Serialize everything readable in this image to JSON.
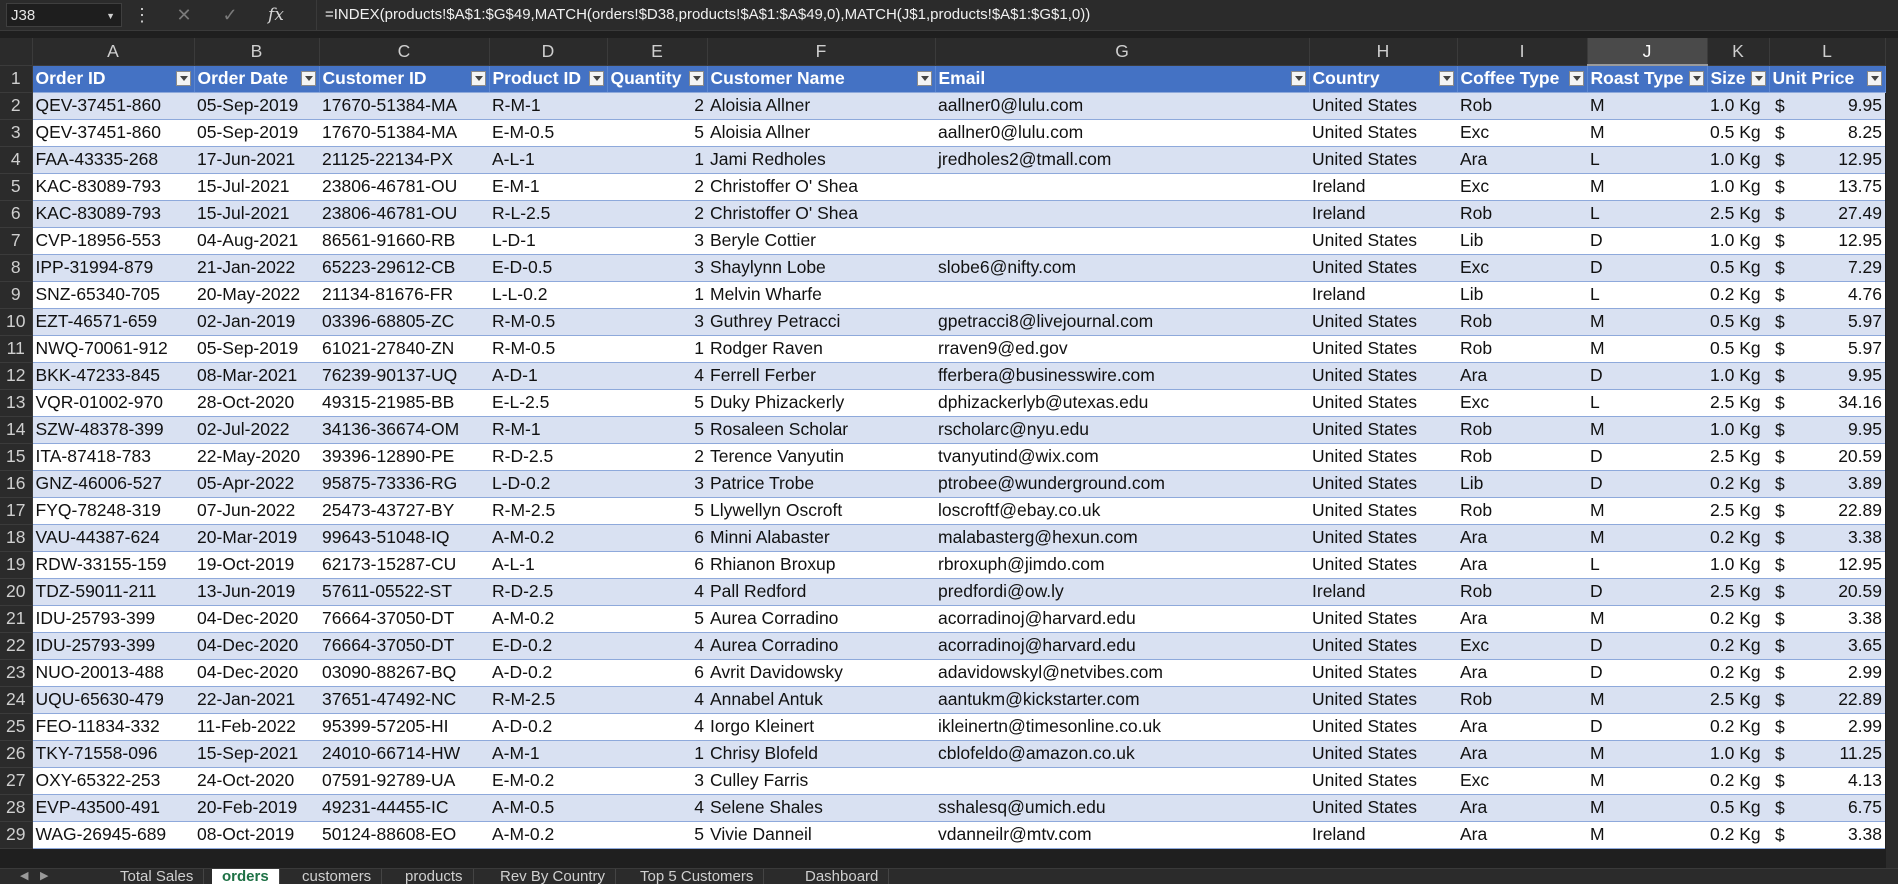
{
  "formula_bar": {
    "name_box": "J38",
    "formula": "=INDEX(products!$A$1:$G$49,MATCH(orders!$D38,products!$A$1:$A$49,0),MATCH(J$1,products!$A$1:$G$1,0))"
  },
  "grid": {
    "columns": [
      "A",
      "B",
      "C",
      "D",
      "E",
      "F",
      "G",
      "H",
      "I",
      "J",
      "K",
      "L"
    ],
    "selected_column": "J",
    "headers": [
      "Order ID",
      "Order Date",
      "Customer ID",
      "Product ID",
      "Quantity",
      "Customer Name",
      "Email",
      "Country",
      "Coffee Type",
      "Roast Type",
      "Size",
      "Unit Price"
    ],
    "rows": [
      {
        "n": "2",
        "c": [
          "QEV-37451-860",
          "05-Sep-2019",
          "17670-51384-MA",
          "R-M-1",
          "2",
          "Aloisia Allner",
          "aallner0@lulu.com",
          "United States",
          "Rob",
          "M",
          "1.0 Kg",
          "9.95"
        ]
      },
      {
        "n": "3",
        "c": [
          "QEV-37451-860",
          "05-Sep-2019",
          "17670-51384-MA",
          "E-M-0.5",
          "5",
          "Aloisia Allner",
          "aallner0@lulu.com",
          "United States",
          "Exc",
          "M",
          "0.5 Kg",
          "8.25"
        ]
      },
      {
        "n": "4",
        "c": [
          "FAA-43335-268",
          "17-Jun-2021",
          "21125-22134-PX",
          "A-L-1",
          "1",
          "Jami Redholes",
          "jredholes2@tmall.com",
          "United States",
          "Ara",
          "L",
          "1.0 Kg",
          "12.95"
        ]
      },
      {
        "n": "5",
        "c": [
          "KAC-83089-793",
          "15-Jul-2021",
          "23806-46781-OU",
          "E-M-1",
          "2",
          "Christoffer O' Shea",
          "",
          "Ireland",
          "Exc",
          "M",
          "1.0 Kg",
          "13.75"
        ]
      },
      {
        "n": "6",
        "c": [
          "KAC-83089-793",
          "15-Jul-2021",
          "23806-46781-OU",
          "R-L-2.5",
          "2",
          "Christoffer O' Shea",
          "",
          "Ireland",
          "Rob",
          "L",
          "2.5 Kg",
          "27.49"
        ]
      },
      {
        "n": "7",
        "c": [
          "CVP-18956-553",
          "04-Aug-2021",
          "86561-91660-RB",
          "L-D-1",
          "3",
          "Beryle Cottier",
          "",
          "United States",
          "Lib",
          "D",
          "1.0 Kg",
          "12.95"
        ]
      },
      {
        "n": "8",
        "c": [
          "IPP-31994-879",
          "21-Jan-2022",
          "65223-29612-CB",
          "E-D-0.5",
          "3",
          "Shaylynn Lobe",
          "slobe6@nifty.com",
          "United States",
          "Exc",
          "D",
          "0.5 Kg",
          "7.29"
        ]
      },
      {
        "n": "9",
        "c": [
          "SNZ-65340-705",
          "20-May-2022",
          "21134-81676-FR",
          "L-L-0.2",
          "1",
          "Melvin Wharfe",
          "",
          "Ireland",
          "Lib",
          "L",
          "0.2 Kg",
          "4.76"
        ]
      },
      {
        "n": "10",
        "c": [
          "EZT-46571-659",
          "02-Jan-2019",
          "03396-68805-ZC",
          "R-M-0.5",
          "3",
          "Guthrey Petracci",
          "gpetracci8@livejournal.com",
          "United States",
          "Rob",
          "M",
          "0.5 Kg",
          "5.97"
        ]
      },
      {
        "n": "11",
        "c": [
          "NWQ-70061-912",
          "05-Sep-2019",
          "61021-27840-ZN",
          "R-M-0.5",
          "1",
          "Rodger Raven",
          "rraven9@ed.gov",
          "United States",
          "Rob",
          "M",
          "0.5 Kg",
          "5.97"
        ]
      },
      {
        "n": "12",
        "c": [
          "BKK-47233-845",
          "08-Mar-2021",
          "76239-90137-UQ",
          "A-D-1",
          "4",
          "Ferrell Ferber",
          "fferbera@businesswire.com",
          "United States",
          "Ara",
          "D",
          "1.0 Kg",
          "9.95"
        ]
      },
      {
        "n": "13",
        "c": [
          "VQR-01002-970",
          "28-Oct-2020",
          "49315-21985-BB",
          "E-L-2.5",
          "5",
          "Duky Phizackerly",
          "dphizackerlyb@utexas.edu",
          "United States",
          "Exc",
          "L",
          "2.5 Kg",
          "34.16"
        ]
      },
      {
        "n": "14",
        "c": [
          "SZW-48378-399",
          "02-Jul-2022",
          "34136-36674-OM",
          "R-M-1",
          "5",
          "Rosaleen Scholar",
          "rscholarc@nyu.edu",
          "United States",
          "Rob",
          "M",
          "1.0 Kg",
          "9.95"
        ]
      },
      {
        "n": "15",
        "c": [
          "ITA-87418-783",
          "22-May-2020",
          "39396-12890-PE",
          "R-D-2.5",
          "2",
          "Terence Vanyutin",
          "tvanyutind@wix.com",
          "United States",
          "Rob",
          "D",
          "2.5 Kg",
          "20.59"
        ]
      },
      {
        "n": "16",
        "c": [
          "GNZ-46006-527",
          "05-Apr-2022",
          "95875-73336-RG",
          "L-D-0.2",
          "3",
          "Patrice Trobe",
          "ptrobee@wunderground.com",
          "United States",
          "Lib",
          "D",
          "0.2 Kg",
          "3.89"
        ]
      },
      {
        "n": "17",
        "c": [
          "FYQ-78248-319",
          "07-Jun-2022",
          "25473-43727-BY",
          "R-M-2.5",
          "5",
          "Llywellyn Oscroft",
          "loscroftf@ebay.co.uk",
          "United States",
          "Rob",
          "M",
          "2.5 Kg",
          "22.89"
        ]
      },
      {
        "n": "18",
        "c": [
          "VAU-44387-624",
          "20-Mar-2019",
          "99643-51048-IQ",
          "A-M-0.2",
          "6",
          "Minni Alabaster",
          "malabasterg@hexun.com",
          "United States",
          "Ara",
          "M",
          "0.2 Kg",
          "3.38"
        ]
      },
      {
        "n": "19",
        "c": [
          "RDW-33155-159",
          "19-Oct-2019",
          "62173-15287-CU",
          "A-L-1",
          "6",
          "Rhianon Broxup",
          "rbroxuph@jimdo.com",
          "United States",
          "Ara",
          "L",
          "1.0 Kg",
          "12.95"
        ]
      },
      {
        "n": "20",
        "c": [
          "TDZ-59011-211",
          "13-Jun-2019",
          "57611-05522-ST",
          "R-D-2.5",
          "4",
          "Pall Redford",
          "predfordi@ow.ly",
          "Ireland",
          "Rob",
          "D",
          "2.5 Kg",
          "20.59"
        ]
      },
      {
        "n": "21",
        "c": [
          "IDU-25793-399",
          "04-Dec-2020",
          "76664-37050-DT",
          "A-M-0.2",
          "5",
          "Aurea Corradino",
          "acorradinoj@harvard.edu",
          "United States",
          "Ara",
          "M",
          "0.2 Kg",
          "3.38"
        ]
      },
      {
        "n": "22",
        "c": [
          "IDU-25793-399",
          "04-Dec-2020",
          "76664-37050-DT",
          "E-D-0.2",
          "4",
          "Aurea Corradino",
          "acorradinoj@harvard.edu",
          "United States",
          "Exc",
          "D",
          "0.2 Kg",
          "3.65"
        ]
      },
      {
        "n": "23",
        "c": [
          "NUO-20013-488",
          "04-Dec-2020",
          "03090-88267-BQ",
          "A-D-0.2",
          "6",
          "Avrit Davidowsky",
          "adavidowskyl@netvibes.com",
          "United States",
          "Ara",
          "D",
          "0.2 Kg",
          "2.99"
        ]
      },
      {
        "n": "24",
        "c": [
          "UQU-65630-479",
          "22-Jan-2021",
          "37651-47492-NC",
          "R-M-2.5",
          "4",
          "Annabel Antuk",
          "aantukm@kickstarter.com",
          "United States",
          "Rob",
          "M",
          "2.5 Kg",
          "22.89"
        ]
      },
      {
        "n": "25",
        "c": [
          "FEO-11834-332",
          "11-Feb-2022",
          "95399-57205-HI",
          "A-D-0.2",
          "4",
          "Iorgo Kleinert",
          "ikleinertn@timesonline.co.uk",
          "United States",
          "Ara",
          "D",
          "0.2 Kg",
          "2.99"
        ]
      },
      {
        "n": "26",
        "c": [
          "TKY-71558-096",
          "15-Sep-2021",
          "24010-66714-HW",
          "A-M-1",
          "1",
          "Chrisy Blofeld",
          "cblofeldo@amazon.co.uk",
          "United States",
          "Ara",
          "M",
          "1.0 Kg",
          "11.25"
        ]
      },
      {
        "n": "27",
        "c": [
          "OXY-65322-253",
          "24-Oct-2020",
          "07591-92789-UA",
          "E-M-0.2",
          "3",
          "Culley Farris",
          "",
          "United States",
          "Exc",
          "M",
          "0.2 Kg",
          "4.13"
        ]
      },
      {
        "n": "28",
        "c": [
          "EVP-43500-491",
          "20-Feb-2019",
          "49231-44455-IC",
          "A-M-0.5",
          "4",
          "Selene Shales",
          "sshalesq@umich.edu",
          "United States",
          "Ara",
          "M",
          "0.5 Kg",
          "6.75"
        ]
      },
      {
        "n": "29",
        "c": [
          "WAG-26945-689",
          "08-Oct-2019",
          "50124-88608-EO",
          "A-M-0.2",
          "5",
          "Vivie Danneil",
          "vdanneilr@mtv.com",
          "Ireland",
          "Ara",
          "M",
          "0.2 Kg",
          "3.38"
        ]
      }
    ]
  },
  "sheet_tabs": [
    "Total Sales",
    "orders",
    "customers",
    "products",
    "Rev By Country",
    "Top 5 Customers",
    "Dashboard"
  ],
  "active_tab": "orders",
  "currency_symbol": "$",
  "colors": {
    "header_fill": "#4472c4",
    "band_fill": "#d9e1f2",
    "chrome": "#2b2b2b"
  }
}
